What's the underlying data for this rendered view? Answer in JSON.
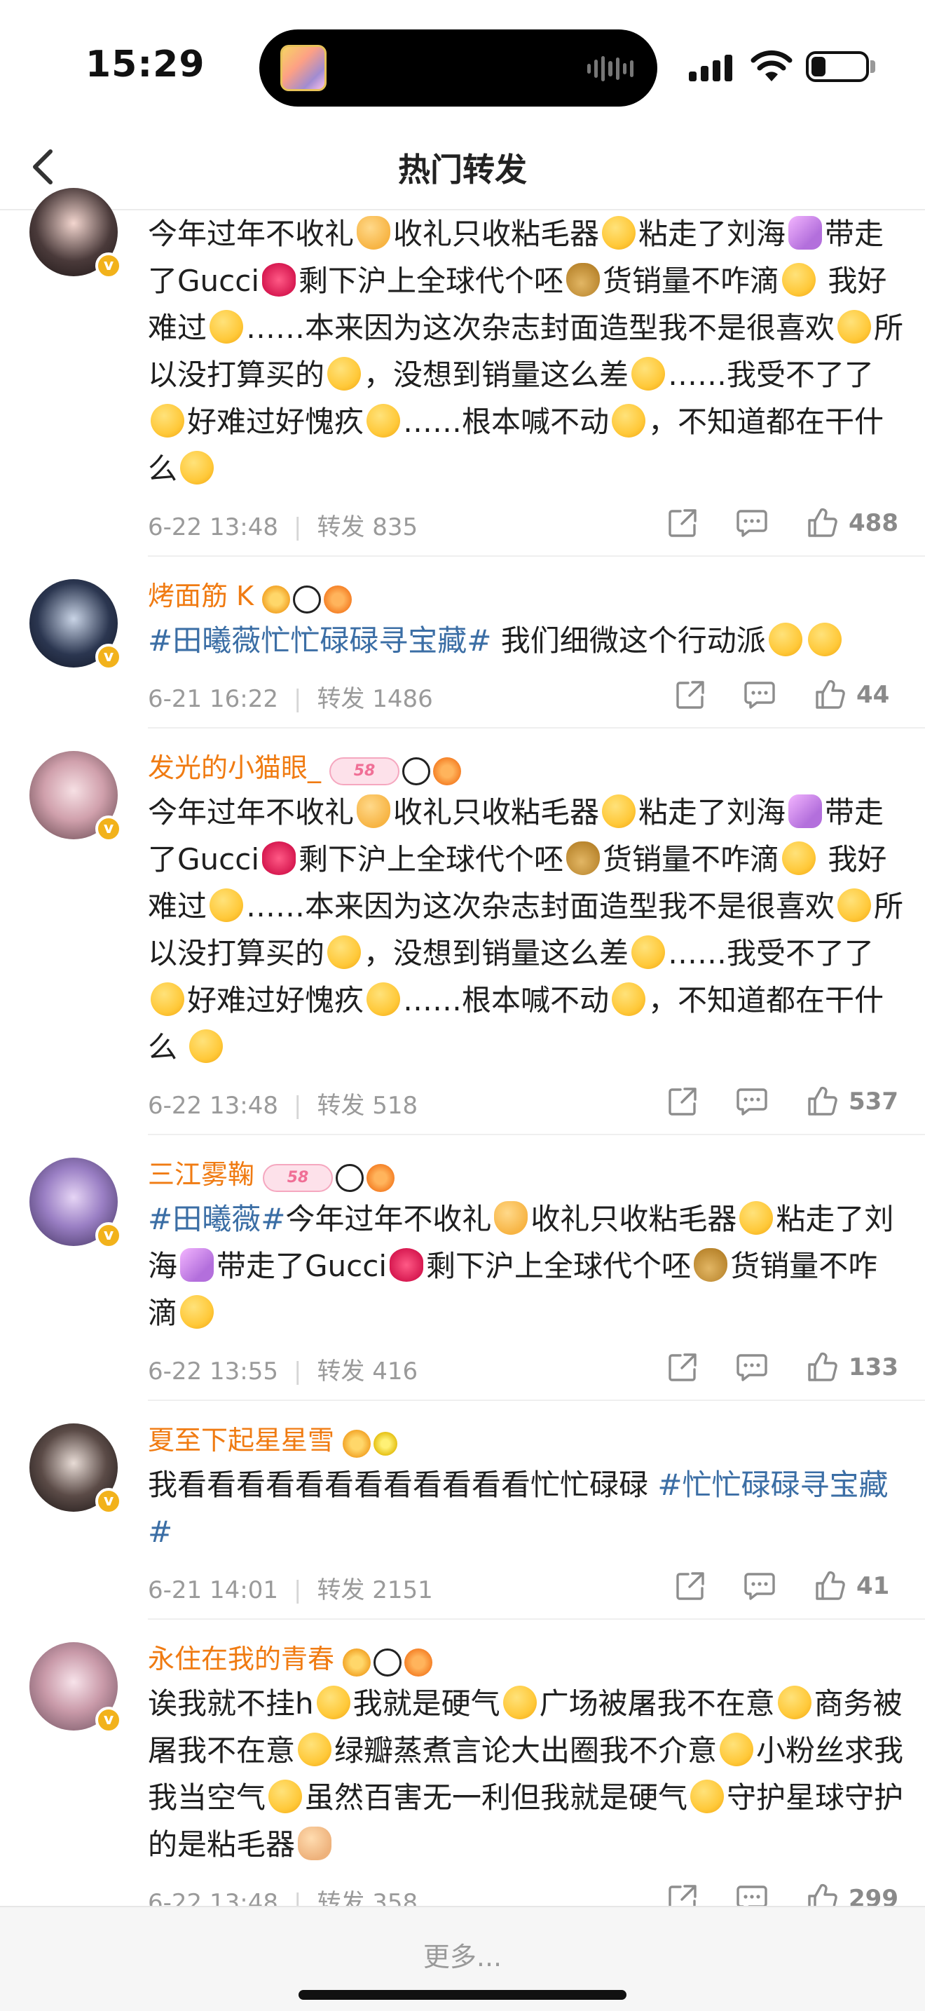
{
  "status_bar": {
    "time": "15:29",
    "battery_level": 0.24
  },
  "header": {
    "title": "热门转发"
  },
  "posts": [
    {
      "username": "",
      "content_segments": [
        {
          "t": "text",
          "v": "今年过年不收礼"
        },
        {
          "t": "emo",
          "k": "e-hand"
        },
        {
          "t": "text",
          "v": "收礼只收粘毛器"
        },
        {
          "t": "emo",
          "k": "e-face"
        },
        {
          "t": "text",
          "v": "粘走了刘海"
        },
        {
          "t": "emo",
          "k": "e-nail"
        },
        {
          "t": "text",
          "v": "带走了Gucci"
        },
        {
          "t": "emo",
          "k": "e-lips"
        },
        {
          "t": "text",
          "v": "剩下沪上全球代个呸"
        },
        {
          "t": "emo",
          "k": "e-bag"
        },
        {
          "t": "text",
          "v": "货销量不咋滴"
        },
        {
          "t": "emo",
          "k": "e-face"
        },
        {
          "t": "text",
          "v": " 我好难过"
        },
        {
          "t": "emo",
          "k": "e-face"
        },
        {
          "t": "text",
          "v": "……本来因为这次杂志封面造型我不是很喜欢"
        },
        {
          "t": "emo",
          "k": "e-face"
        },
        {
          "t": "text",
          "v": "所以没打算买的"
        },
        {
          "t": "emo",
          "k": "e-face"
        },
        {
          "t": "text",
          "v": "，没想到销量这么差"
        },
        {
          "t": "emo",
          "k": "e-face"
        },
        {
          "t": "text",
          "v": "……我受不了了"
        },
        {
          "t": "emo",
          "k": "e-face"
        },
        {
          "t": "text",
          "v": "好难过好愧疚"
        },
        {
          "t": "emo",
          "k": "e-face"
        },
        {
          "t": "text",
          "v": "……根本喊不动"
        },
        {
          "t": "emo",
          "k": "e-face"
        },
        {
          "t": "text",
          "v": "，不知道都在干什么"
        },
        {
          "t": "emo",
          "k": "e-face"
        }
      ],
      "date": "6-22 13:48",
      "repost": "转发 835",
      "likes": "488"
    },
    {
      "username": "烤面筋 K",
      "content_segments": [
        {
          "t": "tag",
          "v": "#田曦薇忙忙碌碌寻宝藏#"
        },
        {
          "t": "text",
          "v": " 我们细微这个行动派"
        },
        {
          "t": "emo",
          "k": "e-face"
        },
        {
          "t": "emo",
          "k": "e-face"
        }
      ],
      "date": "6-21 16:22",
      "repost": "转发 1486",
      "likes": "44"
    },
    {
      "username": "发光的小猫眼_",
      "cake_badge": "58",
      "content_segments": [
        {
          "t": "text",
          "v": "今年过年不收礼"
        },
        {
          "t": "emo",
          "k": "e-hand"
        },
        {
          "t": "text",
          "v": "收礼只收粘毛器"
        },
        {
          "t": "emo",
          "k": "e-face"
        },
        {
          "t": "text",
          "v": "粘走了刘海"
        },
        {
          "t": "emo",
          "k": "e-nail"
        },
        {
          "t": "text",
          "v": "带走了Gucci"
        },
        {
          "t": "emo",
          "k": "e-lips"
        },
        {
          "t": "text",
          "v": "剩下沪上全球代个呸"
        },
        {
          "t": "emo",
          "k": "e-bag"
        },
        {
          "t": "text",
          "v": "货销量不咋滴"
        },
        {
          "t": "emo",
          "k": "e-face"
        },
        {
          "t": "text",
          "v": " 我好难过"
        },
        {
          "t": "emo",
          "k": "e-face"
        },
        {
          "t": "text",
          "v": "……本来因为这次杂志封面造型我不是很喜欢"
        },
        {
          "t": "emo",
          "k": "e-face"
        },
        {
          "t": "text",
          "v": "所以没打算买的"
        },
        {
          "t": "emo",
          "k": "e-face"
        },
        {
          "t": "text",
          "v": "，没想到销量这么差"
        },
        {
          "t": "emo",
          "k": "e-face"
        },
        {
          "t": "text",
          "v": "……我受不了了"
        },
        {
          "t": "emo",
          "k": "e-face"
        },
        {
          "t": "text",
          "v": "好难过好愧疚"
        },
        {
          "t": "emo",
          "k": "e-face"
        },
        {
          "t": "text",
          "v": "……根本喊不动"
        },
        {
          "t": "emo",
          "k": "e-face"
        },
        {
          "t": "text",
          "v": "，不知道都在干什么 "
        },
        {
          "t": "emo",
          "k": "e-face"
        }
      ],
      "date": "6-22 13:48",
      "repost": "转发 518",
      "likes": "537"
    },
    {
      "username": "三江雾鞠",
      "cake_badge": "58",
      "content_segments": [
        {
          "t": "tag",
          "v": "#田曦薇#"
        },
        {
          "t": "text",
          "v": "今年过年不收礼"
        },
        {
          "t": "emo",
          "k": "e-hand"
        },
        {
          "t": "text",
          "v": "收礼只收粘毛器"
        },
        {
          "t": "emo",
          "k": "e-face"
        },
        {
          "t": "text",
          "v": "粘走了刘海"
        },
        {
          "t": "emo",
          "k": "e-nail"
        },
        {
          "t": "text",
          "v": "带走了Gucci"
        },
        {
          "t": "emo",
          "k": "e-lips"
        },
        {
          "t": "text",
          "v": "剩下沪上全球代个呸"
        },
        {
          "t": "emo",
          "k": "e-bag"
        },
        {
          "t": "text",
          "v": "货销量不咋滴"
        },
        {
          "t": "emo",
          "k": "e-face"
        }
      ],
      "date": "6-22 13:55",
      "repost": "转发 416",
      "likes": "133"
    },
    {
      "username": "夏至下起星星雪",
      "content_segments": [
        {
          "t": "text",
          "v": "我看看看看看看看看看看看看忙忙碌碌 "
        },
        {
          "t": "tag",
          "v": "#忙忙碌碌寻宝藏#"
        }
      ],
      "date": "6-21 14:01",
      "repost": "转发 2151",
      "likes": "41"
    },
    {
      "username": "永住在我的青春",
      "content_segments": [
        {
          "t": "text",
          "v": "诶我就不挂h"
        },
        {
          "t": "emo",
          "k": "e-face"
        },
        {
          "t": "text",
          "v": "我就是硬气"
        },
        {
          "t": "emo",
          "k": "e-face"
        },
        {
          "t": "text",
          "v": "广场被屠我不在意"
        },
        {
          "t": "emo",
          "k": "e-face"
        },
        {
          "t": "text",
          "v": "商务被屠我不在意"
        },
        {
          "t": "emo",
          "k": "e-face"
        },
        {
          "t": "text",
          "v": "绿瓣蒸煮言论大出圈我不介意"
        },
        {
          "t": "emo",
          "k": "e-face"
        },
        {
          "t": "text",
          "v": "小粉丝求我我当空气"
        },
        {
          "t": "emo",
          "k": "e-face"
        },
        {
          "t": "text",
          "v": "虽然百害无一利但我就是硬气"
        },
        {
          "t": "emo",
          "k": "e-face"
        },
        {
          "t": "text",
          "v": "守护星球守护的是粘毛器"
        },
        {
          "t": "emo",
          "k": "e-fing"
        }
      ],
      "date": "6-22 13:48",
      "repost": "转发 358",
      "likes": "299"
    }
  ],
  "footer": {
    "more_label": "更多..."
  },
  "colors": {
    "username": "#f07b12",
    "hashtag": "#3b6ea5",
    "meta": "#9a9a9a",
    "verified_badge": "#f2b21b"
  }
}
